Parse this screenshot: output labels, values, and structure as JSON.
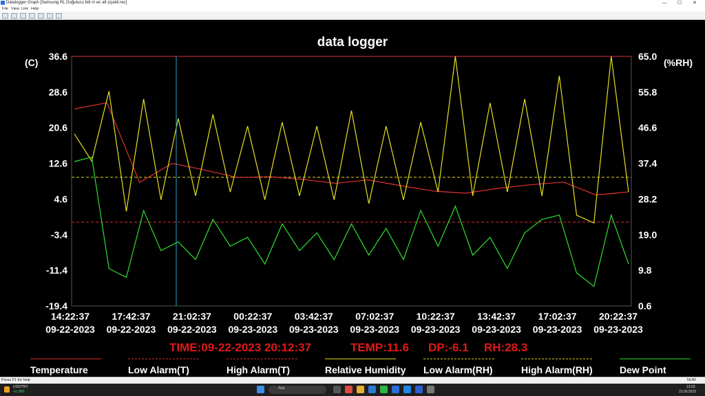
{
  "window": {
    "title": "Datalogger Graph [Samsung RL Doğutucu böl  m en alt çiçekli.rec]",
    "min": "—",
    "max": "☐",
    "close": "✕"
  },
  "menu": [
    "File",
    "View",
    "Link",
    "Help"
  ],
  "toolbar_icons": [
    "new-icon",
    "open-icon",
    "save-icon",
    "print-icon",
    "print-preview-icon",
    "zoom-fit-icon",
    "zoom-icon"
  ],
  "chart_data": {
    "type": "line",
    "title": "data logger",
    "y_left_label": "(C)",
    "y_right_label": "(%RH)",
    "y_left_ticks": [
      "36.6",
      "28.6",
      "20.6",
      "12.6",
      "4.6",
      "-3.4",
      "-11.4",
      "-19.4"
    ],
    "y_right_ticks": [
      "65.0",
      "55.8",
      "46.6",
      "37.4",
      "28.2",
      "19.0",
      "9.8",
      "0.6"
    ],
    "y_left_range": [
      -19.4,
      36.6
    ],
    "y_right_range": [
      0.6,
      65.0
    ],
    "x_ticks": [
      {
        "time": "14:22:37",
        "date": "09-22-2023"
      },
      {
        "time": "17:42:37",
        "date": "09-22-2023"
      },
      {
        "time": "21:02:37",
        "date": "09-22-2023"
      },
      {
        "time": "00:22:37",
        "date": "09-23-2023"
      },
      {
        "time": "03:42:37",
        "date": "09-23-2023"
      },
      {
        "time": "07:02:37",
        "date": "09-23-2023"
      },
      {
        "time": "10:22:37",
        "date": "09-23-2023"
      },
      {
        "time": "13:42:37",
        "date": "09-23-2023"
      },
      {
        "time": "17:02:37",
        "date": "09-23-2023"
      },
      {
        "time": "20:22:37",
        "date": "09-23-2023"
      }
    ],
    "cursor_readout": {
      "time": "TIME:09-22-2023 20:12:37",
      "temp": "TEMP:11.6",
      "dp": "DP:-6.1",
      "rh": "RH:28.3"
    },
    "cursor_time": "09-22-2023 20:12:37",
    "thresholds": {
      "high_alarm_t": 36.6,
      "low_alarm_t": -0.6,
      "high_alarm_rh": 65.0,
      "low_alarm_rh": 33.8
    },
    "series": [
      {
        "name": "Temperature",
        "color": "#e03030",
        "values": [
          24.8,
          26.2,
          8.3,
          12.6,
          11.1,
          9.4,
          9.6,
          9.0,
          8.1,
          8.9,
          7.6,
          6.4,
          5.9,
          7.0,
          7.8,
          8.4,
          5.5,
          6.2
        ]
      },
      {
        "name": "Relative Humidity",
        "color": "#e8e020",
        "values": [
          45.0,
          38.0,
          56.0,
          25.0,
          54.0,
          28.0,
          49.0,
          29.0,
          50.0,
          30.0,
          47.0,
          28.0,
          48.0,
          29.0,
          47.0,
          28.0,
          51.0,
          27.0,
          47.0,
          28.0,
          48.0,
          30.0,
          65.0,
          29.0,
          53.0,
          30.0,
          54.0,
          29.0,
          60.0,
          24.0,
          22.0,
          65.0,
          30.0
        ]
      },
      {
        "name": "Dew Point",
        "color": "#30e030",
        "values": [
          13.0,
          14.0,
          -11.0,
          -13.0,
          2.0,
          -7.0,
          -5.0,
          -9.0,
          0.0,
          -6.0,
          -4.0,
          -10.0,
          -1.0,
          -7.0,
          -3.0,
          -9.0,
          -1.0,
          -8.0,
          -2.0,
          -9.0,
          2.0,
          -6.0,
          3.0,
          -8.0,
          -4.0,
          -11.0,
          -3.0,
          0.0,
          1.0,
          -12.0,
          -15.0,
          1.0,
          -10.0
        ]
      }
    ],
    "legend": [
      {
        "label": "Temperature",
        "color": "#e03030",
        "style": "solid"
      },
      {
        "label": "Low Alarm(T)",
        "color": "#e03030",
        "style": "dashed"
      },
      {
        "label": "High Alarm(T)",
        "color": "#e03030",
        "style": "dashed"
      },
      {
        "label": "Relative Humidity",
        "color": "#e8e020",
        "style": "solid"
      },
      {
        "label": "Low Alarm(RH)",
        "color": "#e8e020",
        "style": "dashed"
      },
      {
        "label": "High Alarm(RH)",
        "color": "#e8e020",
        "style": "dashed"
      },
      {
        "label": "Dew Point",
        "color": "#30e030",
        "style": "solid"
      }
    ],
    "grid": false
  },
  "statusbar": {
    "help": "Press F1 for help",
    "mode": "NUM"
  },
  "taskbar": {
    "ticker": "USD/TRY",
    "ticker_change": "+0,38%",
    "search_placeholder": "Ara",
    "clock_time": "13:03",
    "clock_date": "23.09.2023"
  }
}
